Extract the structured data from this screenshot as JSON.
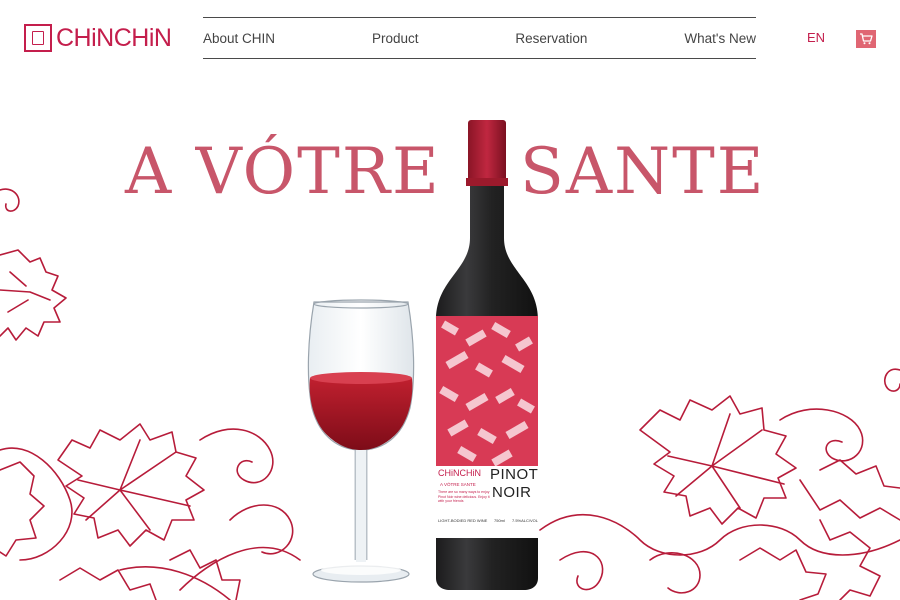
{
  "brand": {
    "logo_text": "CHiNCHiN",
    "logo_mark_text": "CHIN"
  },
  "nav": {
    "items": [
      {
        "label": "About CHIN"
      },
      {
        "label": "Product"
      },
      {
        "label": "Reservation"
      },
      {
        "label": "What's New"
      }
    ],
    "language": "EN"
  },
  "hero": {
    "headline_left": "A VÓTRE",
    "headline_right": "SANTE"
  },
  "bottle_label": {
    "brand": "CHiNCHiN",
    "tagline": "A VÓTRE SANTE",
    "blurb": "There are so many ways to enjoy Pinot Noir wine delicious. Enjoy it with your friends",
    "name_line1": "PINOT",
    "name_line2": "NOIR",
    "type": "LIGHT-BODIED RED WINE",
    "volume": "750ml",
    "abv": "7.5%ALC/VOL"
  },
  "colors": {
    "accent": "#c41e4c",
    "headline": "#c8566a",
    "wine": "#8f1020",
    "cart": "#e06673"
  },
  "icons": {
    "cart": "cart-icon"
  }
}
